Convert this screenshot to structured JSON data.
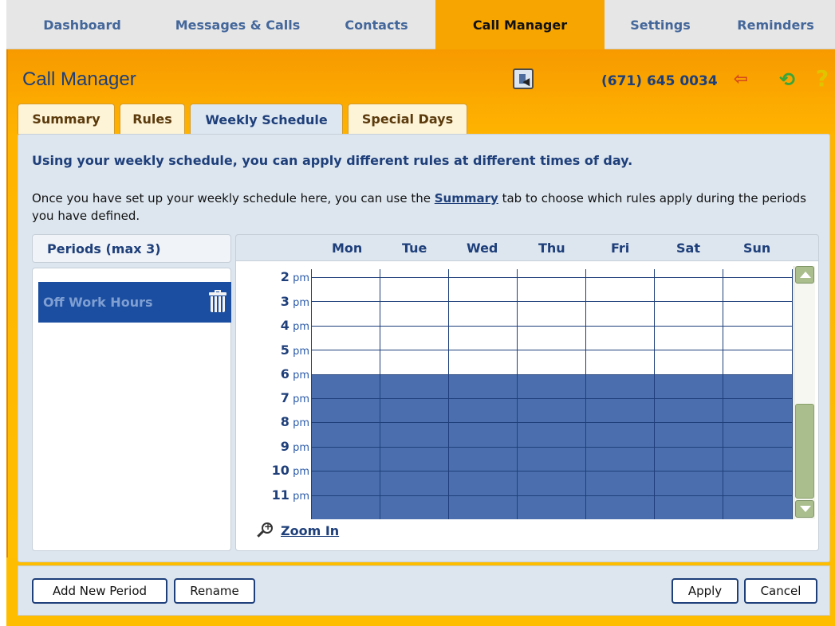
{
  "topnav": {
    "tabs": [
      {
        "label": "Dashboard",
        "active": false
      },
      {
        "label": "Messages & Calls",
        "active": false
      },
      {
        "label": "Contacts",
        "active": false
      },
      {
        "label": "Call Manager",
        "active": true
      },
      {
        "label": "Settings",
        "active": false
      },
      {
        "label": "Reminders",
        "active": false
      }
    ]
  },
  "header": {
    "title": "Call Manager",
    "phone": "(671) 645 0034",
    "icons": [
      "picker-icon",
      "logout-icon",
      "refresh-icon",
      "help-icon"
    ]
  },
  "subtabs": [
    {
      "label": "Summary",
      "active": false
    },
    {
      "label": "Rules",
      "active": false
    },
    {
      "label": "Weekly Schedule",
      "active": true
    },
    {
      "label": "Special Days",
      "active": false
    }
  ],
  "content": {
    "headline": "Using your weekly schedule, you can apply different rules at different times of day.",
    "desc_before": "Once you have set up your weekly schedule here, you can use the ",
    "desc_link": "Summary",
    "desc_after": " tab to choose which rules apply during the periods you have defined."
  },
  "periods": {
    "header": "Periods (max 3)",
    "items": [
      {
        "label": "Off Work Hours",
        "selected": true
      }
    ]
  },
  "schedule": {
    "days": [
      "Mon",
      "Tue",
      "Wed",
      "Thu",
      "Fri",
      "Sat",
      "Sun"
    ],
    "hours": [
      {
        "num": "2",
        "suffix": "pm"
      },
      {
        "num": "3",
        "suffix": "pm"
      },
      {
        "num": "4",
        "suffix": "pm"
      },
      {
        "num": "5",
        "suffix": "pm"
      },
      {
        "num": "6",
        "suffix": "pm"
      },
      {
        "num": "7",
        "suffix": "pm"
      },
      {
        "num": "8",
        "suffix": "pm"
      },
      {
        "num": "9",
        "suffix": "pm"
      },
      {
        "num": "10",
        "suffix": "pm"
      },
      {
        "num": "11",
        "suffix": "pm"
      }
    ],
    "highlighted_period": "Off Work Hours",
    "highlight_color": "#4b6fae",
    "zoom_label": "Zoom In"
  },
  "footer": {
    "add_label": "Add New Period",
    "rename_label": "Rename",
    "apply_label": "Apply",
    "cancel_label": "Cancel"
  },
  "colors": {
    "accent": "#f7a500",
    "navy": "#1e3f7a",
    "selected_period": "#1b4ea0"
  }
}
